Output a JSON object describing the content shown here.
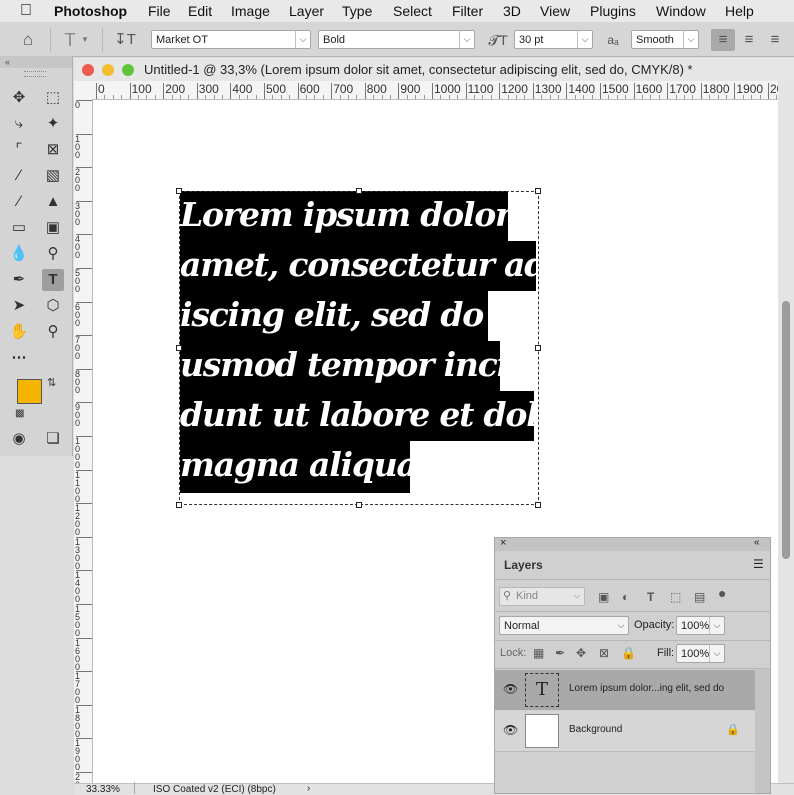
{
  "menubar": {
    "app": "Photoshop",
    "items": [
      "File",
      "Edit",
      "Image",
      "Layer",
      "Type",
      "Select",
      "Filter",
      "3D",
      "View",
      "Plugins",
      "Window",
      "Help"
    ]
  },
  "options": {
    "font_family": "Market OT",
    "font_style": "Bold",
    "font_size": "30 pt",
    "antialias_label": "aₐ",
    "antialias": "Smooth"
  },
  "document": {
    "title": "Untitled-1 @ 33,3% (Lorem ipsum dolor sit amet, consectetur adipiscing elit, sed do, CMYK/8) *",
    "ruler_h": [
      "0",
      "100",
      "200",
      "300",
      "400",
      "500",
      "600",
      "700",
      "800",
      "900",
      "1000",
      "1100",
      "1200",
      "1300",
      "1400",
      "1500",
      "1600",
      "1700",
      "1800",
      "1900",
      "20"
    ],
    "ruler_v": [
      "0",
      "1 0 0",
      "2 0 0",
      "3 0 0",
      "4 0 0",
      "5 0 0",
      "6 0 0",
      "7 0 0",
      "8 0 0",
      "9 0 0",
      "1 0 0 0",
      "1 1 0 0",
      "1 2 0 0",
      "1 3 0 0",
      "1 4 0 0",
      "1 5 0 0",
      "1 6 0 0",
      "1 7 0 0",
      "1 8 0 0",
      "1 9 0 0",
      "2 0 0 0"
    ],
    "text_lines": [
      "Lorem ipsum dolor sit",
      "amet, consectetur adip-",
      "iscing elit, sed do ei-",
      "usmod tempor incidi-",
      "dunt ut labore et dolore",
      "magna aliqua."
    ]
  },
  "status": {
    "zoom": "33.33%",
    "profile": "ISO Coated v2 (ECI) (8bpc)"
  },
  "layers_panel": {
    "title": "Layers",
    "filter_placeholder": "Kind",
    "blend_mode": "Normal",
    "opacity_label": "Opacity:",
    "opacity": "100%",
    "lock_label": "Lock:",
    "fill_label": "Fill:",
    "fill": "100%",
    "layers": [
      {
        "name": "Lorem ipsum dolor...ing elit, sed do",
        "type": "text",
        "selected": true
      },
      {
        "name": "Background",
        "type": "background",
        "selected": false
      }
    ]
  },
  "colors": {
    "foreground": "#f5b400",
    "background": "#ffffff"
  }
}
